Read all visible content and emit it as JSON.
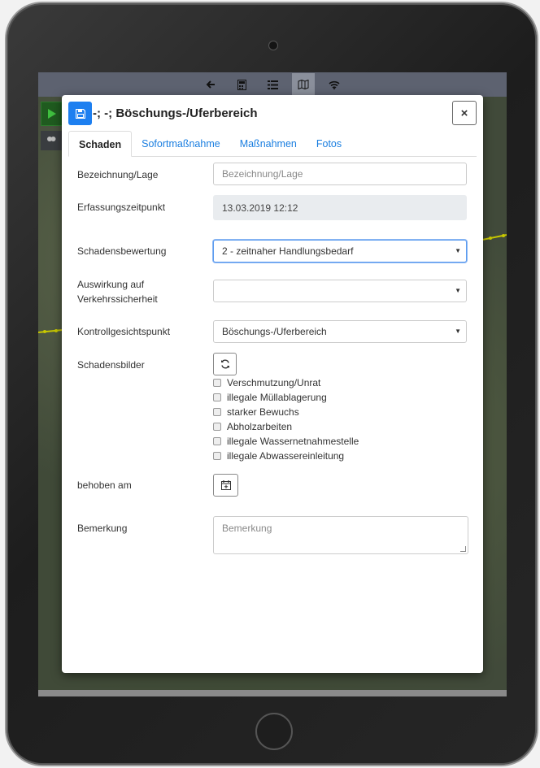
{
  "modal": {
    "title": "-; -; Böschungs-/Uferbereich",
    "save_icon": "save-icon",
    "close_label": "×"
  },
  "tabs": [
    {
      "label": "Schaden",
      "active": true
    },
    {
      "label": "Sofortmaßnahme",
      "active": false
    },
    {
      "label": "Maßnahmen",
      "active": false
    },
    {
      "label": "Fotos",
      "active": false
    }
  ],
  "form": {
    "bezeichnung": {
      "label": "Bezeichnung/Lage",
      "value": "",
      "placeholder": "Bezeichnung/Lage"
    },
    "erfassung": {
      "label": "Erfassungszeitpunkt",
      "value": "13.03.2019 12:12"
    },
    "bewertung": {
      "label": "Schadensbewertung",
      "value": "2 - zeitnaher Handlungsbedarf"
    },
    "auswirkung": {
      "label_line1": "Auswirkung auf",
      "label_line2": "Verkehrssicherheit",
      "value": ""
    },
    "kontroll": {
      "label": "Kontrollgesichtspunkt",
      "value": "Böschungs-/Uferbereich"
    },
    "schadensbilder": {
      "label": "Schadensbilder",
      "refresh_icon": "refresh-icon",
      "options": [
        {
          "label": "Verschmutzung/Unrat",
          "checked": false
        },
        {
          "label": "illegale Müllablagerung",
          "checked": false
        },
        {
          "label": "starker Bewuchs",
          "checked": false
        },
        {
          "label": "Abholzarbeiten",
          "checked": false
        },
        {
          "label": "illegale Wassernetnahmestelle",
          "checked": false
        },
        {
          "label": "illegale Abwassereinleitung",
          "checked": false
        }
      ]
    },
    "behoben": {
      "label": "behoben am",
      "calendar_icon": "calendar-plus-icon"
    },
    "bemerkung": {
      "label": "Bemerkung",
      "value": "",
      "placeholder": "Bemerkung"
    }
  },
  "colors": {
    "accent": "#1d7ff0",
    "tab_link": "#1a7ee0",
    "readonly_bg": "#e9ecef",
    "map_road": "#c8c800"
  }
}
